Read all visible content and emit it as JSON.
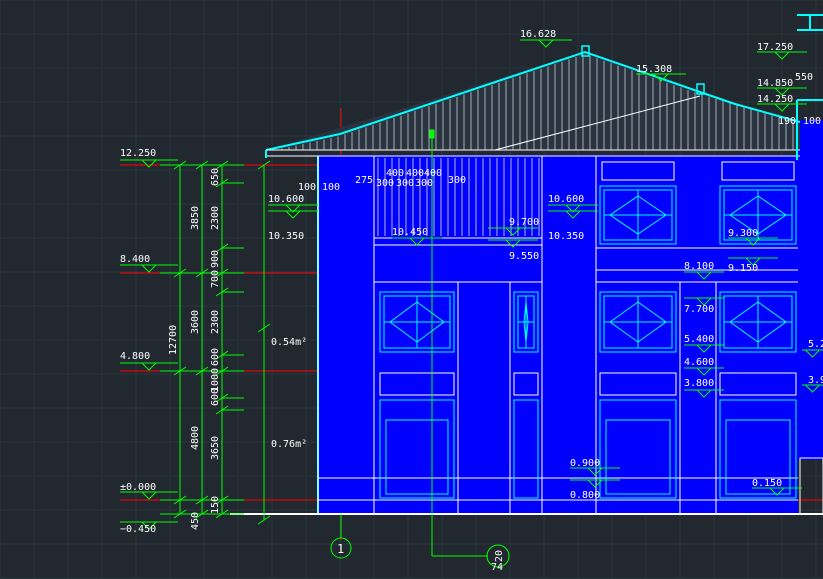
{
  "drawing": {
    "colors": {
      "background": "#212830",
      "grid": "#2c343d",
      "facade": "#0000ff",
      "outline": "#ffffff",
      "roof": "#00ffff",
      "dimension": "#00ff00",
      "axis": "#ff0000",
      "text": "#ffffff"
    },
    "left_levels": [
      {
        "label": "12.250"
      },
      {
        "label": "8.400"
      },
      {
        "label": "4.800"
      },
      {
        "label": "±0.000"
      },
      {
        "label": "−0.450"
      }
    ],
    "dim_total": "12700",
    "dim_floors": [
      "3850",
      "3600",
      "4800",
      "450"
    ],
    "dim_parts": [
      "650",
      "2300",
      "900",
      "700",
      "2300",
      "600",
      "1000",
      "600",
      "3650",
      "150"
    ],
    "top_levels": [
      {
        "label": "16.628"
      },
      {
        "label": "15.308"
      },
      {
        "label": "17.250"
      },
      {
        "label": "14.850"
      },
      {
        "label": "14.250"
      },
      {
        "label": "550"
      },
      {
        "label": "100"
      },
      {
        "label": "190"
      }
    ],
    "facade_labels": [
      {
        "label": "10.600"
      },
      {
        "label": "10.350"
      },
      {
        "label": "100"
      },
      {
        "label": "100"
      },
      {
        "label": "275"
      },
      {
        "label": "400"
      },
      {
        "label": "400"
      },
      {
        "label": "400"
      },
      {
        "label": "300"
      },
      {
        "label": "300"
      },
      {
        "label": "300"
      },
      {
        "label": "300"
      },
      {
        "label": "10.450"
      },
      {
        "label": "9.700"
      },
      {
        "label": "9.550"
      },
      {
        "label": "10.600"
      },
      {
        "label": "10.350"
      },
      {
        "label": "9.300"
      },
      {
        "label": "8.100"
      },
      {
        "label": "9.150"
      },
      {
        "label": "7.700"
      },
      {
        "label": "5.400"
      },
      {
        "label": "4.600"
      },
      {
        "label": "3.800"
      },
      {
        "label": "5.2"
      },
      {
        "label": "3.9"
      },
      {
        "label": "0.900"
      },
      {
        "label": "0.800"
      },
      {
        "label": "0.150"
      },
      {
        "label": "0.54m²"
      },
      {
        "label": "0.76m²"
      }
    ],
    "axis_bubbles": [
      {
        "label": "1"
      },
      {
        "label": "20"
      },
      {
        "label": "74"
      }
    ]
  }
}
